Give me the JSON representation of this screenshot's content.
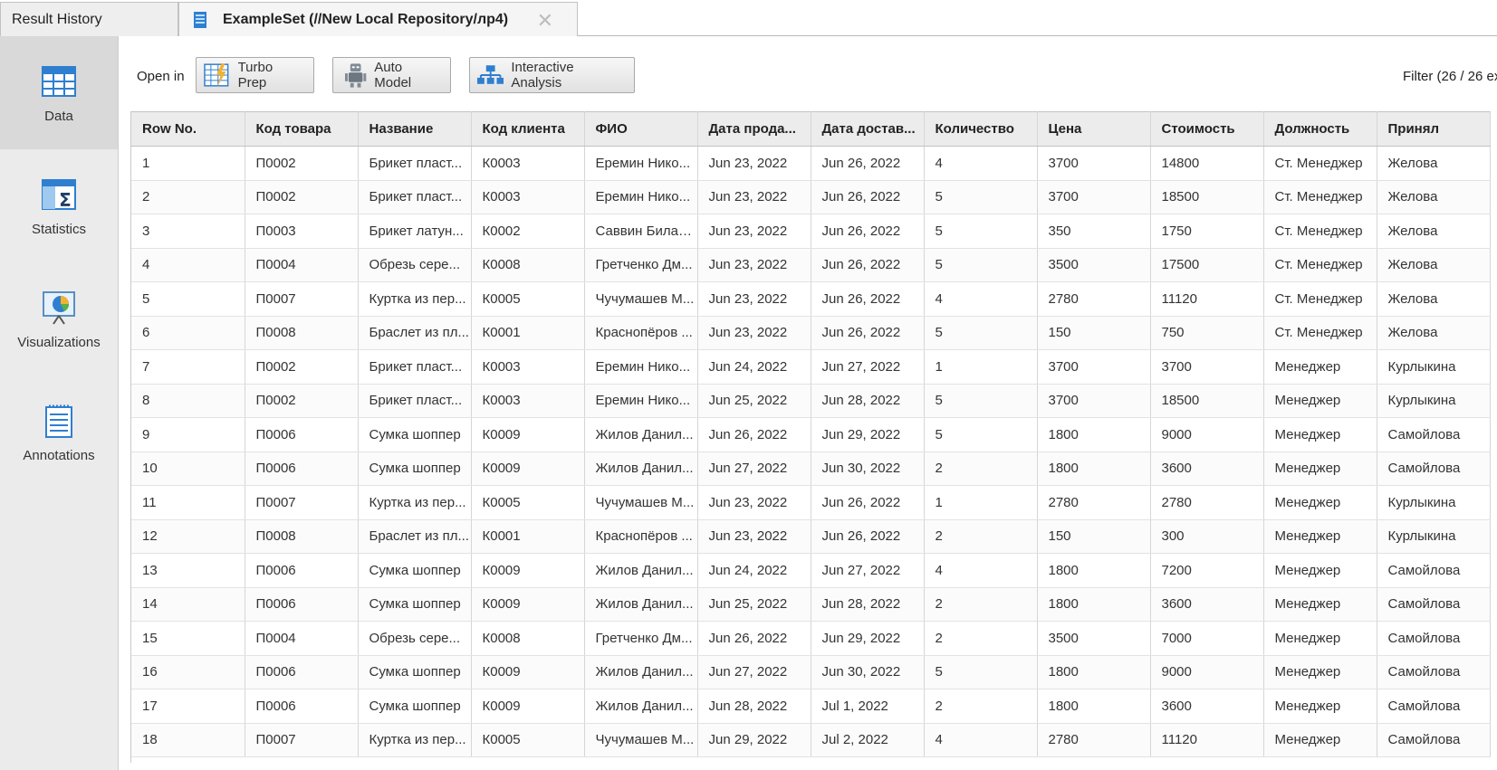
{
  "tabs": {
    "result_history": "Result History",
    "example_set": "ExampleSet (//New Local Repository/лр4)",
    "close_glyph": "✕"
  },
  "sidebar": {
    "items": [
      {
        "label": "Data",
        "icon": "data-table-icon",
        "active": true
      },
      {
        "label": "Statistics",
        "icon": "statistics-sigma-icon",
        "active": false
      },
      {
        "label": "Visualizations",
        "icon": "visualization-chart-icon",
        "active": false
      },
      {
        "label": "Annotations",
        "icon": "annotations-notepad-icon",
        "active": false
      }
    ]
  },
  "toolbar": {
    "open_in": "Open in",
    "turbo_prep": "Turbo Prep",
    "auto_model": "Auto Model",
    "interactive_analysis": "Interactive Analysis",
    "filter": "Filter (26 / 26 ex"
  },
  "table": {
    "columns": [
      "Row No.",
      "Код товара",
      "Название",
      "Код клиента",
      "ФИО",
      "Дата прода...",
      "Дата достав...",
      "Количество",
      "Цена",
      "Стоимость",
      "Должность",
      "Принял"
    ],
    "rows": [
      [
        "1",
        "П0002",
        "Брикет пласт...",
        "К0003",
        "Еремин Нико...",
        "Jun 23, 2022",
        "Jun 26, 2022",
        "4",
        "3700",
        "14800",
        "Ст. Менеджер",
        "Желова"
      ],
      [
        "2",
        "П0002",
        "Брикет пласт...",
        "К0003",
        "Еремин Нико...",
        "Jun 23, 2022",
        "Jun 26, 2022",
        "5",
        "3700",
        "18500",
        "Ст. Менеджер",
        "Желова"
      ],
      [
        "3",
        "П0003",
        "Брикет латун...",
        "К0002",
        "Саввин Билал...",
        "Jun 23, 2022",
        "Jun 26, 2022",
        "5",
        "350",
        "1750",
        "Ст. Менеджер",
        "Желова"
      ],
      [
        "4",
        "П0004",
        "Обрезь сере...",
        "К0008",
        "Гретченко Дм...",
        "Jun 23, 2022",
        "Jun 26, 2022",
        "5",
        "3500",
        "17500",
        "Ст. Менеджер",
        "Желова"
      ],
      [
        "5",
        "П0007",
        "Куртка из пер...",
        "К0005",
        "Чучумашев М...",
        "Jun 23, 2022",
        "Jun 26, 2022",
        "4",
        "2780",
        "11120",
        "Ст. Менеджер",
        "Желова"
      ],
      [
        "6",
        "П0008",
        "Браслет из пл...",
        "К0001",
        "Краснопёров ...",
        "Jun 23, 2022",
        "Jun 26, 2022",
        "5",
        "150",
        "750",
        "Ст. Менеджер",
        "Желова"
      ],
      [
        "7",
        "П0002",
        "Брикет пласт...",
        "К0003",
        "Еремин Нико...",
        "Jun 24, 2022",
        "Jun 27, 2022",
        "1",
        "3700",
        "3700",
        "Менеджер",
        "Курлыкина"
      ],
      [
        "8",
        "П0002",
        "Брикет пласт...",
        "К0003",
        "Еремин Нико...",
        "Jun 25, 2022",
        "Jun 28, 2022",
        "5",
        "3700",
        "18500",
        "Менеджер",
        "Курлыкина"
      ],
      [
        "9",
        "П0006",
        "Сумка шоппер",
        "К0009",
        "Жилов Данил...",
        "Jun 26, 2022",
        "Jun 29, 2022",
        "5",
        "1800",
        "9000",
        "Менеджер",
        "Самойлова"
      ],
      [
        "10",
        "П0006",
        "Сумка шоппер",
        "К0009",
        "Жилов Данил...",
        "Jun 27, 2022",
        "Jun 30, 2022",
        "2",
        "1800",
        "3600",
        "Менеджер",
        "Самойлова"
      ],
      [
        "11",
        "П0007",
        "Куртка из пер...",
        "К0005",
        "Чучумашев М...",
        "Jun 23, 2022",
        "Jun 26, 2022",
        "1",
        "2780",
        "2780",
        "Менеджер",
        "Курлыкина"
      ],
      [
        "12",
        "П0008",
        "Браслет из пл...",
        "К0001",
        "Краснопёров ...",
        "Jun 23, 2022",
        "Jun 26, 2022",
        "2",
        "150",
        "300",
        "Менеджер",
        "Курлыкина"
      ],
      [
        "13",
        "П0006",
        "Сумка шоппер",
        "К0009",
        "Жилов Данил...",
        "Jun 24, 2022",
        "Jun 27, 2022",
        "4",
        "1800",
        "7200",
        "Менеджер",
        "Самойлова"
      ],
      [
        "14",
        "П0006",
        "Сумка шоппер",
        "К0009",
        "Жилов Данил...",
        "Jun 25, 2022",
        "Jun 28, 2022",
        "2",
        "1800",
        "3600",
        "Менеджер",
        "Самойлова"
      ],
      [
        "15",
        "П0004",
        "Обрезь сере...",
        "К0008",
        "Гретченко Дм...",
        "Jun 26, 2022",
        "Jun 29, 2022",
        "2",
        "3500",
        "7000",
        "Менеджер",
        "Самойлова"
      ],
      [
        "16",
        "П0006",
        "Сумка шоппер",
        "К0009",
        "Жилов Данил...",
        "Jun 27, 2022",
        "Jun 30, 2022",
        "5",
        "1800",
        "9000",
        "Менеджер",
        "Самойлова"
      ],
      [
        "17",
        "П0006",
        "Сумка шоппер",
        "К0009",
        "Жилов Данил...",
        "Jun 28, 2022",
        "Jul 1, 2022",
        "2",
        "1800",
        "3600",
        "Менеджер",
        "Самойлова"
      ],
      [
        "18",
        "П0007",
        "Куртка из пер...",
        "К0005",
        "Чучумашев М...",
        "Jun 29, 2022",
        "Jul 2, 2022",
        "4",
        "2780",
        "11120",
        "Менеджер",
        "Самойлова"
      ]
    ]
  },
  "colors": {
    "accent_blue": "#2f7fd0",
    "header_bg": "#ececec",
    "sidebar_bg": "#ebebeb"
  }
}
